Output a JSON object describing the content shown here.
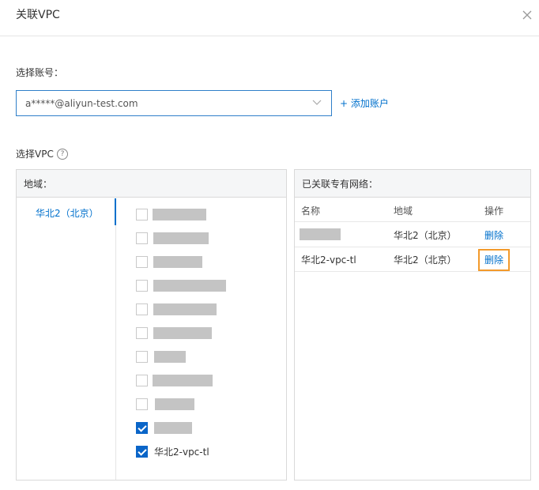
{
  "dialog": {
    "title": "关联VPC"
  },
  "account": {
    "label": "选择账号：",
    "value": "a*****@aliyun-test.com",
    "add_label": "+ 添加账户"
  },
  "vpc_select": {
    "label": "选择VPC",
    "help_glyph": "?",
    "left_panel": {
      "header": "地域：",
      "regions": [
        "华北2（北京）"
      ],
      "vpcs": [
        {
          "name": "",
          "checked": false,
          "redacted": true
        },
        {
          "name": "",
          "checked": false,
          "redacted": true
        },
        {
          "name": "",
          "checked": false,
          "redacted": true
        },
        {
          "name": "",
          "checked": false,
          "redacted": true
        },
        {
          "name": "",
          "checked": false,
          "redacted": true
        },
        {
          "name": "",
          "checked": false,
          "redacted": true
        },
        {
          "name": "",
          "checked": false,
          "redacted": true
        },
        {
          "name": "",
          "checked": false,
          "redacted": true
        },
        {
          "name": "",
          "checked": false,
          "redacted": true
        },
        {
          "name": "",
          "checked": true,
          "redacted": true
        },
        {
          "name": "华北2-vpc-tl",
          "checked": true,
          "redacted": false
        }
      ]
    },
    "right_panel": {
      "header": "已关联专有网络：",
      "columns": [
        "名称",
        "地域",
        "操作"
      ],
      "rows": [
        {
          "name": "",
          "redacted": true,
          "region": "华北2（北京）",
          "action": "删除",
          "highlighted": false
        },
        {
          "name": "华北2-vpc-tl",
          "redacted": false,
          "region": "华北2（北京）",
          "action": "删除",
          "highlighted": true
        }
      ]
    }
  },
  "colors": {
    "link": "#0070cc",
    "highlight": "#f39a2b",
    "checkbox": "#0a65c8",
    "redaction": "#c4c4c4"
  }
}
